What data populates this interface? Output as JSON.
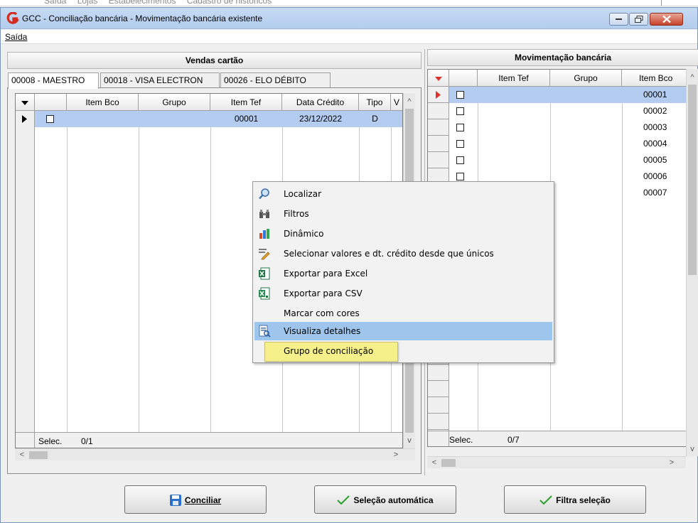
{
  "background_menu": [
    "Saída",
    "Lojas",
    "Estabelecimentos",
    "Cadastro de históricos"
  ],
  "window": {
    "title": "GCC - Conciliação bancária - Movimentação bancária existente",
    "menu": "Saída"
  },
  "left_panel": {
    "title": "Vendas cartão",
    "tabs": [
      "00008 - MAESTRO",
      "00018 - VISA ELECTRON",
      "00026 - ELO DÉBITO"
    ],
    "columns": [
      "Item Bco",
      "Grupo",
      "Item Tef",
      "Data Crédito",
      "Tipo",
      "V"
    ],
    "rows": [
      {
        "item_bco": "",
        "grupo": "",
        "item_tef": "00001",
        "data_credito": "23/12/2022",
        "tipo": "D",
        "checked": false
      }
    ],
    "footer_label": "Selec.",
    "footer_value": "0/1"
  },
  "right_panel": {
    "title": "Movimentação bancária",
    "columns": [
      "Item Tef",
      "Grupo",
      "Item Bco"
    ],
    "rows": [
      "00001",
      "00002",
      "00003",
      "00004",
      "00005",
      "00006",
      "00007"
    ],
    "footer_label": "Selec.",
    "footer_value": "0/7"
  },
  "context_menu": {
    "items": [
      {
        "label": "Localizar",
        "icon": "magnifier-icon"
      },
      {
        "label": "Filtros",
        "icon": "binoculars-icon"
      },
      {
        "label": "Dinâmico",
        "icon": "bar-chart-icon"
      },
      {
        "label": "Selecionar valores e dt. crédito desde que únicos",
        "icon": "pencil-select-icon"
      },
      {
        "label": "Exportar para Excel",
        "icon": "excel-icon"
      },
      {
        "label": "Exportar para CSV",
        "icon": "csv-icon"
      },
      {
        "label": "Marcar com cores",
        "icon": ""
      },
      {
        "label": "Visualiza detalhes",
        "icon": "details-icon"
      }
    ],
    "highlighted": "Visualiza detalhes",
    "tooltip": "Grupo de conciliação"
  },
  "buttons": {
    "conciliar": "Conciliar",
    "selecao_automatica": "Seleção automática",
    "filtra_selecao": "Filtra seleção"
  },
  "colors": {
    "selection": "#b3ccf0",
    "menu_highlight": "#9ec6ec",
    "tooltip": "#f6f08a",
    "indicator_red": "#e0302a",
    "check_green": "#2ca02c",
    "save_blue": "#2a6fc9"
  }
}
